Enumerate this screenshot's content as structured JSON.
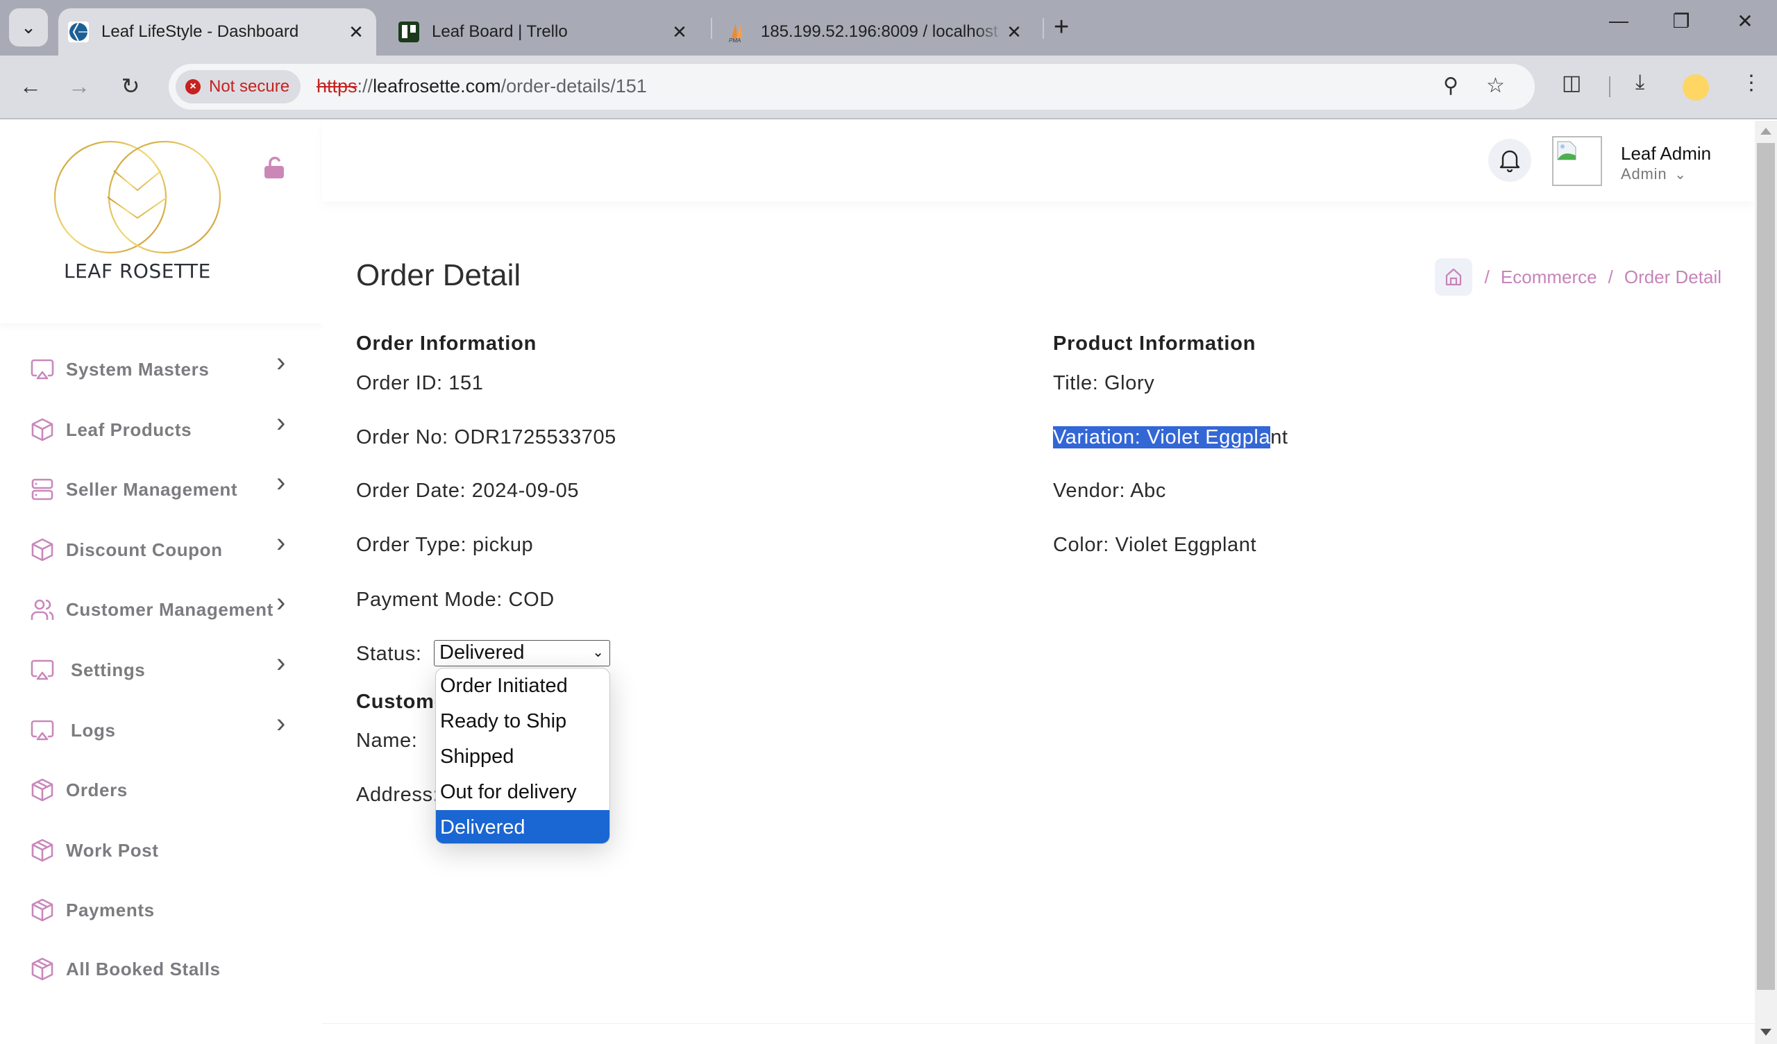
{
  "browser": {
    "tabs": [
      {
        "title": "Leaf LifeStyle - Dashboard",
        "active": true,
        "favicon": "leaf-lifestyle-favicon"
      },
      {
        "title": "Leaf Board | Trello",
        "active": false,
        "favicon": "trello-favicon"
      },
      {
        "title": "185.199.52.196:8009 / localhost",
        "active": false,
        "favicon": "phpmyadmin-favicon"
      }
    ],
    "security_label": "Not secure",
    "url_scheme": "https",
    "url_sep": "://",
    "url_host": "leafrosette.com",
    "url_path": "/order-details/151"
  },
  "sidebar": {
    "brand": "LEAF ROSETTE",
    "items": [
      {
        "label": "System Masters",
        "icon": "airplay-icon",
        "has_children": true
      },
      {
        "label": "Leaf Products",
        "icon": "box-icon",
        "has_children": true
      },
      {
        "label": "Seller Management",
        "icon": "server-icon",
        "has_children": true
      },
      {
        "label": "Discount Coupon",
        "icon": "box-icon",
        "has_children": true
      },
      {
        "label": "Customer Management",
        "icon": "users-icon",
        "has_children": true
      },
      {
        "label": " Settings",
        "icon": "airplay-icon",
        "has_children": true
      },
      {
        "label": " Logs",
        "icon": "airplay-icon",
        "has_children": true
      },
      {
        "label": "Orders",
        "icon": "package-icon",
        "has_children": false
      },
      {
        "label": "Work Post",
        "icon": "package-icon",
        "has_children": false
      },
      {
        "label": "Payments",
        "icon": "package-icon",
        "has_children": false
      },
      {
        "label": "All Booked Stalls",
        "icon": "package-icon",
        "has_children": false
      }
    ]
  },
  "header": {
    "user_name": "Leaf Admin",
    "user_role": "Admin"
  },
  "page": {
    "title": "Order Detail",
    "breadcrumb": [
      "Ecommerce",
      "Order Detail"
    ],
    "order_info": {
      "heading": "Order Information",
      "order_id": "Order ID: 151",
      "order_no": "Order No: ODR1725533705",
      "order_date": "Order Date: 2024-09-05",
      "order_type": "Order Type: pickup",
      "payment_mode": "Payment Mode: COD",
      "status_label": "Status:",
      "status_value": "Delivered",
      "status_options": [
        "Order Initiated",
        "Ready to Ship",
        "Shipped",
        "Out for delivery",
        "Delivered"
      ]
    },
    "customer_info": {
      "heading": "Customer Information",
      "name_label": "Name:",
      "address_label": "Address:"
    },
    "product_info": {
      "heading": "Product Information",
      "title": "Title: Glory",
      "variation_selected": "Variation: Violet Eggpla",
      "variation_rest": "nt",
      "vendor": "Vendor: Abc",
      "color": "Color: Violet Eggplant"
    }
  },
  "colors": {
    "accent": "#c684b8",
    "selection": "#3367d6",
    "option_selected": "#1a66d2",
    "logo_gold": "#c9a23a"
  }
}
